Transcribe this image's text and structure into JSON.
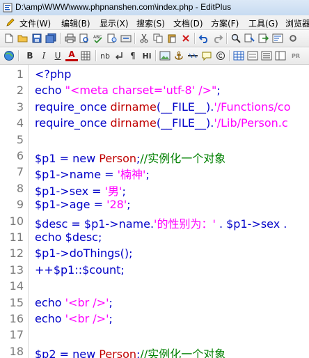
{
  "window": {
    "title": "D:\\amp\\WWW\\www.phpnanshen.com\\index.php - EditPlus"
  },
  "menu": [
    "文件(W)",
    "编辑(B)",
    "显示(X)",
    "搜索(S)",
    "文档(D)",
    "方案(F)",
    "工具(G)",
    "浏览器"
  ],
  "toolbar1": [
    "new-file-icon",
    "open-folder-icon",
    "save-icon",
    "save-all-icon",
    "print-icon",
    "print-preview-icon",
    "spellcheck-icon",
    "find-in-files-icon",
    "cut-icon",
    "copy-icon",
    "paste-icon",
    "delete-icon",
    "undo-icon",
    "redo-icon",
    "search-icon",
    "replace-icon",
    "word-wrap-icon",
    "settings-icon"
  ],
  "toolbar2_labels": {
    "bold": "B",
    "italic": "I",
    "underline": "U",
    "font": "A",
    "nb": "nb",
    "para": "¶",
    "hi": "Hi",
    "pr": "PR"
  },
  "lines": [
    {
      "n": "1",
      "parts": [
        {
          "t": "<?php",
          "c": "code"
        }
      ]
    },
    {
      "n": "2",
      "parts": [
        {
          "t": "echo ",
          "c": "code"
        },
        {
          "t": "\"<meta charset='utf-8' />\"",
          "c": "str"
        },
        {
          "t": ";",
          "c": "code"
        }
      ]
    },
    {
      "n": "3",
      "parts": [
        {
          "t": "require_once ",
          "c": "code"
        },
        {
          "t": "dirname",
          "c": "fn"
        },
        {
          "t": "(__FILE__).",
          "c": "code"
        },
        {
          "t": "'/Functions/co",
          "c": "str"
        }
      ]
    },
    {
      "n": "4",
      "parts": [
        {
          "t": "require_once ",
          "c": "code"
        },
        {
          "t": "dirname",
          "c": "fn"
        },
        {
          "t": "(__FILE__).",
          "c": "code"
        },
        {
          "t": "'/Lib/Person.c",
          "c": "str"
        }
      ]
    },
    {
      "n": "5",
      "parts": []
    },
    {
      "n": "6",
      "parts": [
        {
          "t": "$p1 = new ",
          "c": "code"
        },
        {
          "t": "Person",
          "c": "fn"
        },
        {
          "t": ";",
          "c": "code"
        },
        {
          "t": "//实例化一个对象",
          "c": "cmt"
        }
      ]
    },
    {
      "n": "7",
      "parts": [
        {
          "t": "$p1->name = ",
          "c": "code"
        },
        {
          "t": "'楠神'",
          "c": "str"
        },
        {
          "t": ";",
          "c": "code"
        }
      ]
    },
    {
      "n": "8",
      "parts": [
        {
          "t": "$p1->sex = ",
          "c": "code"
        },
        {
          "t": "'男'",
          "c": "str"
        },
        {
          "t": ";",
          "c": "code"
        }
      ]
    },
    {
      "n": "9",
      "parts": [
        {
          "t": "$p1->age = ",
          "c": "code"
        },
        {
          "t": "'28'",
          "c": "str"
        },
        {
          "t": ";",
          "c": "code"
        }
      ]
    },
    {
      "n": "10",
      "parts": [
        {
          "t": "$desc = $p1->name.",
          "c": "code"
        },
        {
          "t": "'的性别为：'",
          "c": "str"
        },
        {
          "t": " . $p1->sex .",
          "c": "code"
        }
      ]
    },
    {
      "n": "11",
      "parts": [
        {
          "t": "echo $desc;",
          "c": "code"
        }
      ]
    },
    {
      "n": "12",
      "parts": [
        {
          "t": "$p1->doThings();",
          "c": "code"
        }
      ]
    },
    {
      "n": "13",
      "parts": [
        {
          "t": "++$p1::$count;",
          "c": "code"
        }
      ]
    },
    {
      "n": "14",
      "parts": []
    },
    {
      "n": "15",
      "parts": [
        {
          "t": "echo ",
          "c": "code"
        },
        {
          "t": "'<br />'",
          "c": "str"
        },
        {
          "t": ";",
          "c": "code"
        }
      ]
    },
    {
      "n": "16",
      "parts": [
        {
          "t": "echo ",
          "c": "code"
        },
        {
          "t": "'<br />'",
          "c": "str"
        },
        {
          "t": ";",
          "c": "code"
        }
      ]
    },
    {
      "n": "17",
      "parts": []
    },
    {
      "n": "18",
      "parts": [
        {
          "t": "$p2 = new ",
          "c": "code"
        },
        {
          "t": "Person",
          "c": "fn"
        },
        {
          "t": ";",
          "c": "code"
        },
        {
          "t": "//实例化一个对象",
          "c": "cmt"
        }
      ]
    }
  ]
}
